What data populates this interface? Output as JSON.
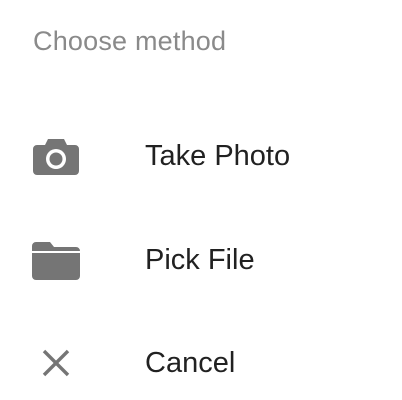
{
  "dialog": {
    "title": "Choose method",
    "options": [
      {
        "label": "Take Photo",
        "icon": "camera-icon"
      },
      {
        "label": "Pick File",
        "icon": "folder-icon"
      },
      {
        "label": "Cancel",
        "icon": "close-icon"
      }
    ],
    "icon_color": "#757575",
    "label_color": "#212121",
    "title_color": "#8a8a8a"
  }
}
